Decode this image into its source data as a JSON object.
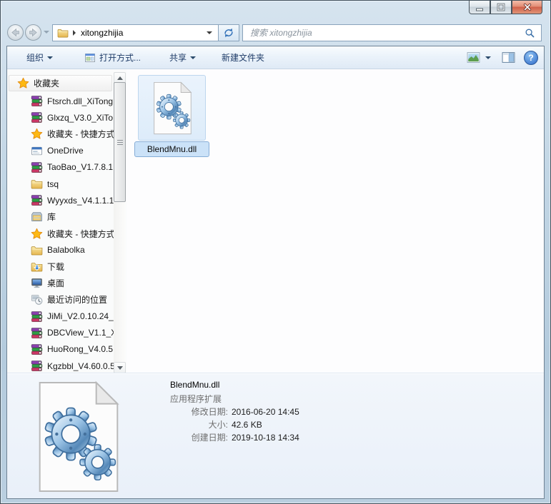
{
  "window": {
    "controls": [
      "minimize",
      "maximize",
      "close"
    ]
  },
  "address_bar": {
    "breadcrumb_folder": "xitongzhijia",
    "search_placeholder": "搜索 xitongzhijia"
  },
  "toolbar": {
    "organize": "组织",
    "open_with": "打开方式...",
    "share": "共享",
    "new_folder": "新建文件夹"
  },
  "sidebar": {
    "items": [
      {
        "label": "收藏夹",
        "icon": "star-icon"
      },
      {
        "label": "Ftsrch.dll_XiTong",
        "icon": "rar-archive-icon"
      },
      {
        "label": "Glxzq_V3.0_XiTo",
        "icon": "rar-archive-icon"
      },
      {
        "label": "收藏夹 - 快捷方式",
        "icon": "star-icon"
      },
      {
        "label": "OneDrive",
        "icon": "onedrive-icon"
      },
      {
        "label": "TaoBao_V1.7.8.1",
        "icon": "rar-archive-icon"
      },
      {
        "label": "tsq",
        "icon": "folder-icon"
      },
      {
        "label": "Wyyxds_V4.1.1.1",
        "icon": "rar-archive-icon"
      },
      {
        "label": "库",
        "icon": "libraries-icon"
      },
      {
        "label": "收藏夹 - 快捷方式",
        "icon": "star-icon"
      },
      {
        "label": "Balabolka",
        "icon": "folder-icon"
      },
      {
        "label": "下载",
        "icon": "downloads-folder-icon"
      },
      {
        "label": "桌面",
        "icon": "desktop-icon"
      },
      {
        "label": "最近访问的位置",
        "icon": "recent-places-icon"
      },
      {
        "label": "JiMi_V2.0.10.24_",
        "icon": "rar-archive-icon"
      },
      {
        "label": "DBCView_V1.1_X",
        "icon": "rar-archive-icon"
      },
      {
        "label": "HuoRong_V4.0.5",
        "icon": "rar-archive-icon"
      },
      {
        "label": "Kgzbbl_V4.60.0.5",
        "icon": "rar-archive-icon"
      }
    ]
  },
  "main": {
    "selected_file": "BlendMnu.dll"
  },
  "details_pane": {
    "file_name": "BlendMnu.dll",
    "file_type": "应用程序扩展",
    "fields": [
      {
        "label": "修改日期:",
        "value": "2016-06-20 14:45"
      },
      {
        "label": "大小:",
        "value": "42.6 KB"
      },
      {
        "label": "创建日期:",
        "value": "2019-10-18 14:34"
      }
    ]
  },
  "icons": {
    "help_glyph": "?",
    "colors": {
      "selection_fill": "#cbe2f8",
      "selection_border": "#86add7",
      "close_button_red": "#cf5f49",
      "toolbar_text": "#1f3c68",
      "gear_blue": "#4e86b8",
      "star_gold": "#fdb913"
    }
  }
}
